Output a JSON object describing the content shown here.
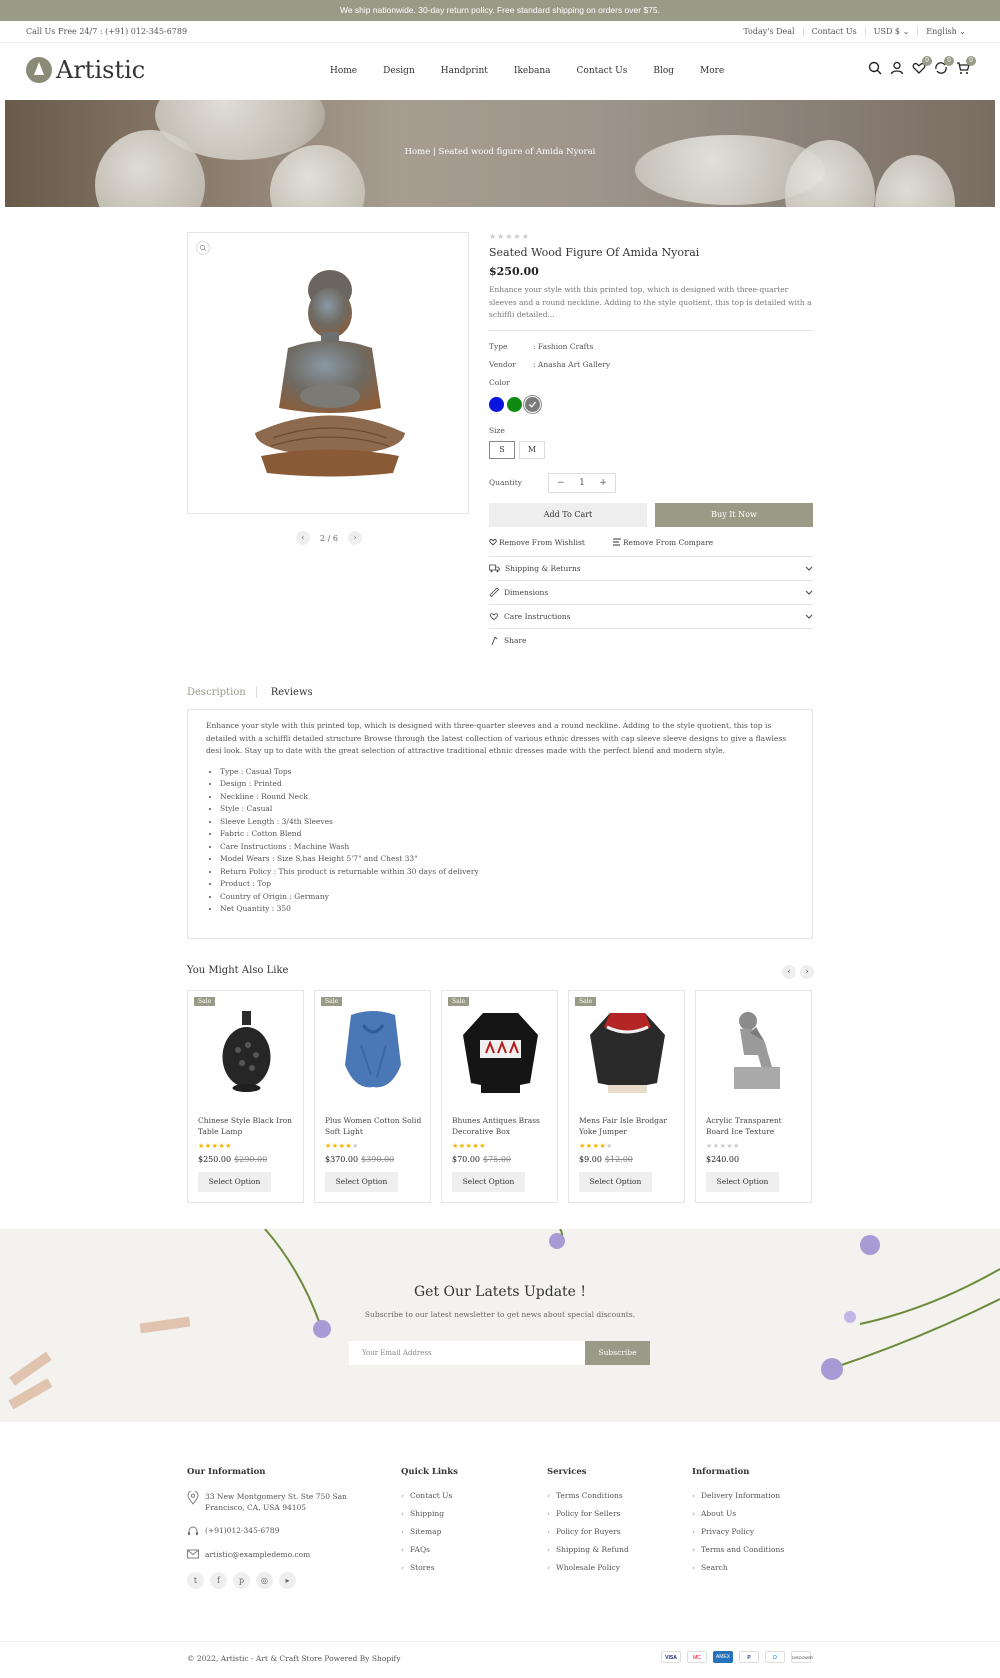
{
  "announcement": "We ship nationwide. 30-day return policy. Free standard shipping on orders over $75.",
  "topbar": {
    "call": "Call Us Free 24/7 : (+91) 012-345-6789",
    "links": [
      "Today's Deal",
      "Contact Us",
      "USD $ ⌄",
      "English ⌄"
    ]
  },
  "header": {
    "logo": "Artistic",
    "nav": [
      "Home",
      "Design",
      "Handprint",
      "Ikebana",
      "Contact Us",
      "Blog",
      "More"
    ],
    "badges": {
      "wishlist": "0",
      "compare": "0",
      "cart": "0"
    }
  },
  "breadcrumb": {
    "home": "Home |",
    "current": "Seated wood figure of Amida Nyorai"
  },
  "gallery": {
    "pager": "2 / 6",
    "prev": "‹",
    "next": "›"
  },
  "product": {
    "stars": "★★★★★",
    "title": "Seated Wood Figure Of Amida Nyorai",
    "price": "$250.00",
    "short_desc": "Enhance your style with this printed top, which is designed with three-quarter sleeves and a round neckline. Adding to the style quotient, this top is detailed with a schiffli detailed...",
    "type_label": "Type",
    "type_value": ": Fashion Crafts",
    "vendor_label": "Vendor",
    "vendor_value": ": Anasha Art Gallery",
    "color_label": "Color",
    "colors": [
      "#0a14e0",
      "#118a13",
      "#7a7a7a"
    ],
    "size_label": "Size",
    "sizes": [
      "S",
      "M"
    ],
    "quantity_label": "Quantity",
    "qty_minus": "−",
    "qty_value": "1",
    "qty_plus": "+",
    "add_to_cart": "Add To Cart",
    "buy_now": "Buy It Now",
    "remove_wishlist": "Remove From Wishlist",
    "remove_compare": "Remove From Compare",
    "accordions": [
      "Shipping & Returns",
      "Dimensions",
      "Care Instructions"
    ],
    "share": "Share"
  },
  "tabs": {
    "description": "Description",
    "reviews": "Reviews"
  },
  "description": {
    "text": "Enhance your style with this printed top, which is designed with three-quarter sleeves and a round neckline. Adding to the style quotient, this top is detailed with a schiffli detailed structure Browse through the latest collection of various ethnic dresses with cap sleeve sleeve designs to give a flawless desi look. Stay up to date with the great selection of attractive traditional ethnic dresses made with the perfect blend and modern style.",
    "specs": [
      "Type : Casual Tops",
      "Design : Printed",
      "Neckline : Round Neck",
      "Style : Casual",
      "Sleeve Length : 3/4th Sleeves",
      "Fabric : Cotton Blend",
      "Care Instructions : Machine Wash",
      "Model Wears : Size S,has Height 5'7\" and Chest 33\"",
      "Return Policy : This product is returnable within 30 days of delivery",
      "Product : Top",
      "Country of Origin : Germany",
      "Net Quantity : 350"
    ]
  },
  "related": {
    "title": "You Might Also Like",
    "prev": "‹",
    "next": "›",
    "items": [
      {
        "name": "Chinese Style Black Iron Table Lamp",
        "sale": "Sale",
        "stars": "★★★★★",
        "rating": 5,
        "price": "$250.00",
        "old": "$290.00",
        "button": "Select Option"
      },
      {
        "name": "Plus Women Cotton Solid Soft Light",
        "sale": "Sale",
        "stars": "★★★★★",
        "rating": 4,
        "price": "$370.00",
        "old": "$390.00",
        "button": "Select Option"
      },
      {
        "name": "Bhunes Antiques Brass Decorative Box",
        "sale": "Sale",
        "stars": "★★★★★",
        "rating": 5,
        "price": "$70.00",
        "old": "$75.00",
        "button": "Select Option"
      },
      {
        "name": "Mens Fair Isle Brodgar Yoke Jumper",
        "sale": "Sale",
        "stars": "★★★★★",
        "rating": 4,
        "price": "$9.00",
        "old": "$12.00",
        "button": "Select Option"
      },
      {
        "name": "Acrylic Transparent Board Ice Texture",
        "sale": "",
        "stars": "★★★★★",
        "rating": 0,
        "price": "$240.00",
        "old": "",
        "button": "Select Option"
      }
    ]
  },
  "newsletter": {
    "title": "Get Our Latets Update !",
    "subtitle": "Subscribe to our latest newsletter to get news about special discounts.",
    "placeholder": "Your Email Address",
    "button": "Subscribe"
  },
  "footer": {
    "info_title": "Our Information",
    "address": "33 New Montgomery St. Ste 750 San Francisco, CA, USA 94105",
    "phone": "(+91)012-345-6789",
    "email": "artistic@exampledemo.com",
    "quick_title": "Quick Links",
    "quick": [
      "Contact Us",
      "Shipping",
      "Sitemap",
      "FAQs",
      "Stores"
    ],
    "services_title": "Services",
    "services": [
      "Terms Conditions",
      "Policy for Sellers",
      "Policy for Buyers",
      "Shipping & Refund",
      "Wholesale Policy"
    ],
    "information_title": "Information",
    "information": [
      "Delivery Information",
      "About Us",
      "Privacy Policy",
      "Terms and Conditions",
      "Search"
    ],
    "copyright": "© 2022, Artistic - Art & Craft Store Powered By Shopify",
    "payments": [
      "VISA",
      "MC",
      "AMEX",
      "P",
      "D",
      "DISCOVER"
    ]
  },
  "colors": {
    "accent": "#9a9b87",
    "star": "#f5b400"
  }
}
